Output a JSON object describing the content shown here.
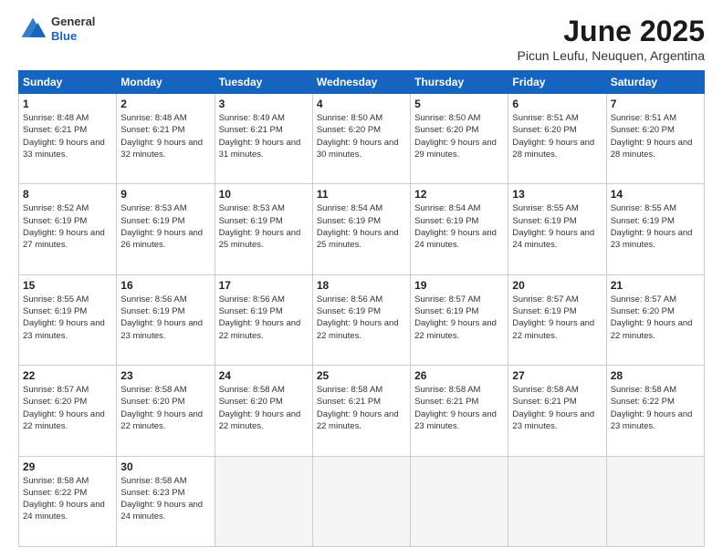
{
  "header": {
    "logo_general": "General",
    "logo_blue": "Blue",
    "title": "June 2025",
    "subtitle": "Picun Leufu, Neuquen, Argentina"
  },
  "days_of_week": [
    "Sunday",
    "Monday",
    "Tuesday",
    "Wednesday",
    "Thursday",
    "Friday",
    "Saturday"
  ],
  "weeks": [
    [
      {
        "day": 1,
        "sunrise": "8:48 AM",
        "sunset": "6:21 PM",
        "daylight": "9 hours and 33 minutes."
      },
      {
        "day": 2,
        "sunrise": "8:48 AM",
        "sunset": "6:21 PM",
        "daylight": "9 hours and 32 minutes."
      },
      {
        "day": 3,
        "sunrise": "8:49 AM",
        "sunset": "6:21 PM",
        "daylight": "9 hours and 31 minutes."
      },
      {
        "day": 4,
        "sunrise": "8:50 AM",
        "sunset": "6:20 PM",
        "daylight": "9 hours and 30 minutes."
      },
      {
        "day": 5,
        "sunrise": "8:50 AM",
        "sunset": "6:20 PM",
        "daylight": "9 hours and 29 minutes."
      },
      {
        "day": 6,
        "sunrise": "8:51 AM",
        "sunset": "6:20 PM",
        "daylight": "9 hours and 28 minutes."
      },
      {
        "day": 7,
        "sunrise": "8:51 AM",
        "sunset": "6:20 PM",
        "daylight": "9 hours and 28 minutes."
      }
    ],
    [
      {
        "day": 8,
        "sunrise": "8:52 AM",
        "sunset": "6:19 PM",
        "daylight": "9 hours and 27 minutes."
      },
      {
        "day": 9,
        "sunrise": "8:53 AM",
        "sunset": "6:19 PM",
        "daylight": "9 hours and 26 minutes."
      },
      {
        "day": 10,
        "sunrise": "8:53 AM",
        "sunset": "6:19 PM",
        "daylight": "9 hours and 25 minutes."
      },
      {
        "day": 11,
        "sunrise": "8:54 AM",
        "sunset": "6:19 PM",
        "daylight": "9 hours and 25 minutes."
      },
      {
        "day": 12,
        "sunrise": "8:54 AM",
        "sunset": "6:19 PM",
        "daylight": "9 hours and 24 minutes."
      },
      {
        "day": 13,
        "sunrise": "8:55 AM",
        "sunset": "6:19 PM",
        "daylight": "9 hours and 24 minutes."
      },
      {
        "day": 14,
        "sunrise": "8:55 AM",
        "sunset": "6:19 PM",
        "daylight": "9 hours and 23 minutes."
      }
    ],
    [
      {
        "day": 15,
        "sunrise": "8:55 AM",
        "sunset": "6:19 PM",
        "daylight": "9 hours and 23 minutes."
      },
      {
        "day": 16,
        "sunrise": "8:56 AM",
        "sunset": "6:19 PM",
        "daylight": "9 hours and 23 minutes."
      },
      {
        "day": 17,
        "sunrise": "8:56 AM",
        "sunset": "6:19 PM",
        "daylight": "9 hours and 22 minutes."
      },
      {
        "day": 18,
        "sunrise": "8:56 AM",
        "sunset": "6:19 PM",
        "daylight": "9 hours and 22 minutes."
      },
      {
        "day": 19,
        "sunrise": "8:57 AM",
        "sunset": "6:19 PM",
        "daylight": "9 hours and 22 minutes."
      },
      {
        "day": 20,
        "sunrise": "8:57 AM",
        "sunset": "6:19 PM",
        "daylight": "9 hours and 22 minutes."
      },
      {
        "day": 21,
        "sunrise": "8:57 AM",
        "sunset": "6:20 PM",
        "daylight": "9 hours and 22 minutes."
      }
    ],
    [
      {
        "day": 22,
        "sunrise": "8:57 AM",
        "sunset": "6:20 PM",
        "daylight": "9 hours and 22 minutes."
      },
      {
        "day": 23,
        "sunrise": "8:58 AM",
        "sunset": "6:20 PM",
        "daylight": "9 hours and 22 minutes."
      },
      {
        "day": 24,
        "sunrise": "8:58 AM",
        "sunset": "6:20 PM",
        "daylight": "9 hours and 22 minutes."
      },
      {
        "day": 25,
        "sunrise": "8:58 AM",
        "sunset": "6:21 PM",
        "daylight": "9 hours and 22 minutes."
      },
      {
        "day": 26,
        "sunrise": "8:58 AM",
        "sunset": "6:21 PM",
        "daylight": "9 hours and 23 minutes."
      },
      {
        "day": 27,
        "sunrise": "8:58 AM",
        "sunset": "6:21 PM",
        "daylight": "9 hours and 23 minutes."
      },
      {
        "day": 28,
        "sunrise": "8:58 AM",
        "sunset": "6:22 PM",
        "daylight": "9 hours and 23 minutes."
      }
    ],
    [
      {
        "day": 29,
        "sunrise": "8:58 AM",
        "sunset": "6:22 PM",
        "daylight": "9 hours and 24 minutes."
      },
      {
        "day": 30,
        "sunrise": "8:58 AM",
        "sunset": "6:23 PM",
        "daylight": "9 hours and 24 minutes."
      },
      null,
      null,
      null,
      null,
      null
    ]
  ]
}
